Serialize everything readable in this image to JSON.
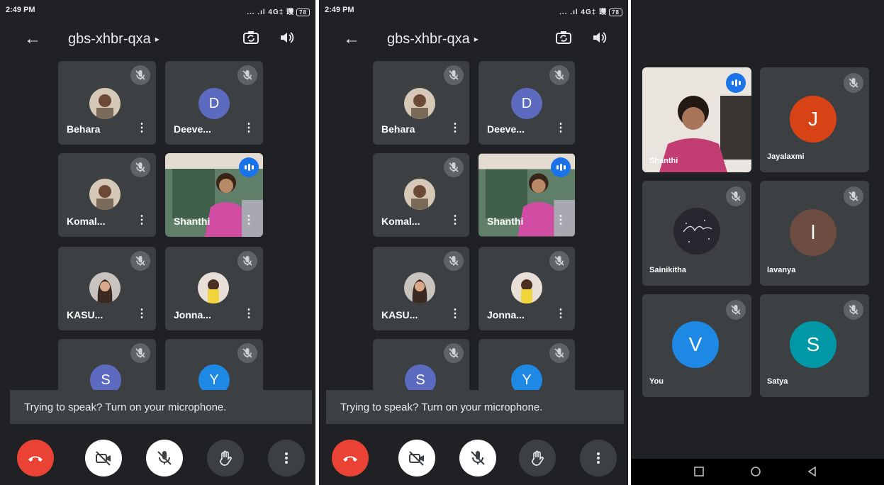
{
  "status": {
    "time": "2:49 PM",
    "signal": "... .ıl 4G‡ 䝄",
    "battery": "78"
  },
  "meeting": {
    "code": "gbs-xhbr-qxa",
    "caret": "▸"
  },
  "participants": {
    "behara": "Behara",
    "deeve": "Deeve...",
    "komal": "Komal...",
    "shanthi": "Shanthi",
    "kasu": "KASU...",
    "jonna": "Jonna...",
    "tile7_initial": "S",
    "tile8_initial": "Y",
    "deeve_initial": "D"
  },
  "toast": {
    "text": "Trying to speak? Turn on your microphone."
  },
  "panel3": {
    "shanthi": "Shanthi",
    "jayalaxmi": "Jayalaxmi",
    "jayalaxmi_initial": "J",
    "sainikitha": "Sainikitha",
    "lavanya": "lavanya",
    "lavanya_initial": "l",
    "you": "You",
    "you_initial": "V",
    "satya": "Satya",
    "satya_initial": "S"
  },
  "colors": {
    "background": "#202124",
    "tile": "#3c4043",
    "end_call": "#ea4335",
    "speaking": "#1a73e8",
    "avatar_d": "#5c6bc0",
    "avatar_s": "#5c6bc0",
    "avatar_y": "#1e88e5",
    "avatar_j": "#d84315",
    "avatar_l": "#6d4c41",
    "avatar_v": "#1e88e5",
    "avatar_satya": "#0097a7"
  },
  "icons": [
    "back-arrow-icon",
    "switch-camera-icon",
    "speaker-icon",
    "mic-off-icon",
    "more-vert-icon",
    "speaking-indicator-icon",
    "end-call-icon",
    "camera-off-icon",
    "raise-hand-icon",
    "square-nav-icon",
    "circle-nav-icon",
    "triangle-nav-icon"
  ]
}
